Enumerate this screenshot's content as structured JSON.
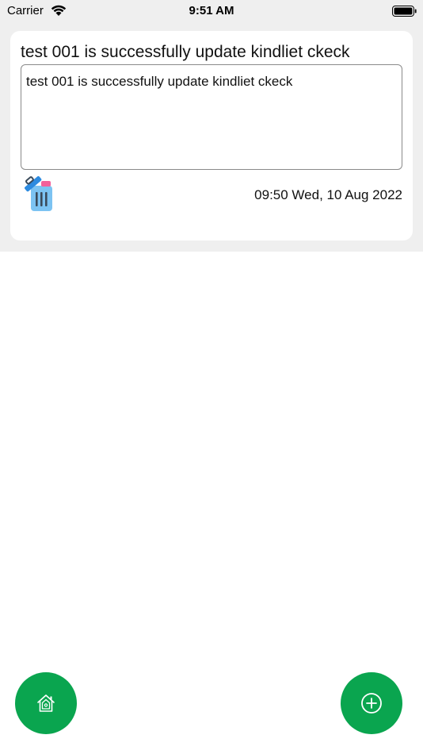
{
  "status_bar": {
    "carrier": "Carrier",
    "time": "9:51 AM"
  },
  "note": {
    "title": "test 001 is successfully update kindliet ckeck",
    "body": "test 001 is successfully update kindliet ckeck",
    "date": "09:50 Wed, 10 Aug 2022"
  },
  "icons": {
    "delete": "trash-can-icon",
    "home": "home-icon",
    "add": "add-circle-icon"
  },
  "colors": {
    "accent": "#0aa54f",
    "background_top": "#efefef",
    "card": "#ffffff"
  }
}
